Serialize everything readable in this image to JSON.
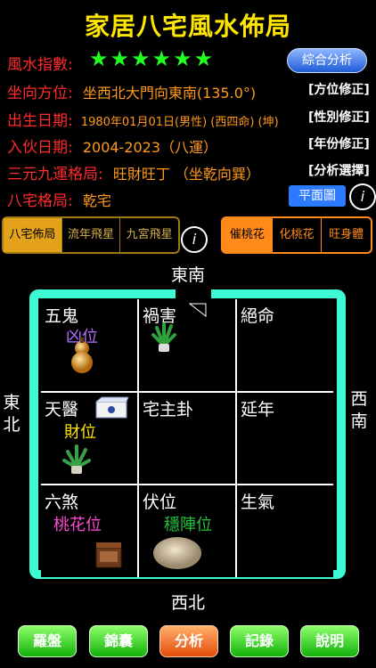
{
  "title": "家居八宅風水佈局",
  "rating": {
    "label": "風水指數:",
    "stars": "★★★★★★"
  },
  "analyze_button": "綜合分析",
  "rows": [
    {
      "label": "坐向方位:",
      "value": "坐西北大門向東南(135.0°)",
      "action": "[方位修正]"
    },
    {
      "label": "出生日期:",
      "value": "1980年01月01日(男性) (西四命) (坤)",
      "action": "[性別修正]"
    },
    {
      "label": "入伙日期:",
      "value": "2004-2023（八運）",
      "action": "[年份修正]"
    },
    {
      "label": "三元九運格局:",
      "value": "旺財旺丁 （坐乾向巽）",
      "action": "[分析選擇]"
    },
    {
      "label": "八宅格局:",
      "value": "乾宅",
      "action": ""
    }
  ],
  "plan_button": "平面圖",
  "tabs_left": [
    "八宅佈局",
    "流年飛星",
    "九宮飛星"
  ],
  "tabs_right": [
    "催桃花",
    "化桃花",
    "旺身體"
  ],
  "directions": {
    "top": "東南",
    "bottom": "西北",
    "left": [
      "東",
      "北"
    ],
    "right": [
      "西",
      "南"
    ]
  },
  "cells": [
    {
      "name": "五鬼",
      "sub": "凶位",
      "color": "#b070ff"
    },
    {
      "name": "禍害",
      "sub": "",
      "color": ""
    },
    {
      "name": "絕命",
      "sub": "",
      "color": ""
    },
    {
      "name": "天醫",
      "sub": "財位",
      "color": "#ffe600"
    },
    {
      "name": "宅主卦",
      "sub": "",
      "color": ""
    },
    {
      "name": "延年",
      "sub": "",
      "color": ""
    },
    {
      "name": "六煞",
      "sub": "桃花位",
      "color": "#ff4bd8"
    },
    {
      "name": "伏位",
      "sub": "穩陣位",
      "color": "#23c23c"
    },
    {
      "name": "生氣",
      "sub": "",
      "color": ""
    }
  ],
  "bottom_nav": [
    "羅盤",
    "錦囊",
    "分析",
    "記錄",
    "說明"
  ]
}
